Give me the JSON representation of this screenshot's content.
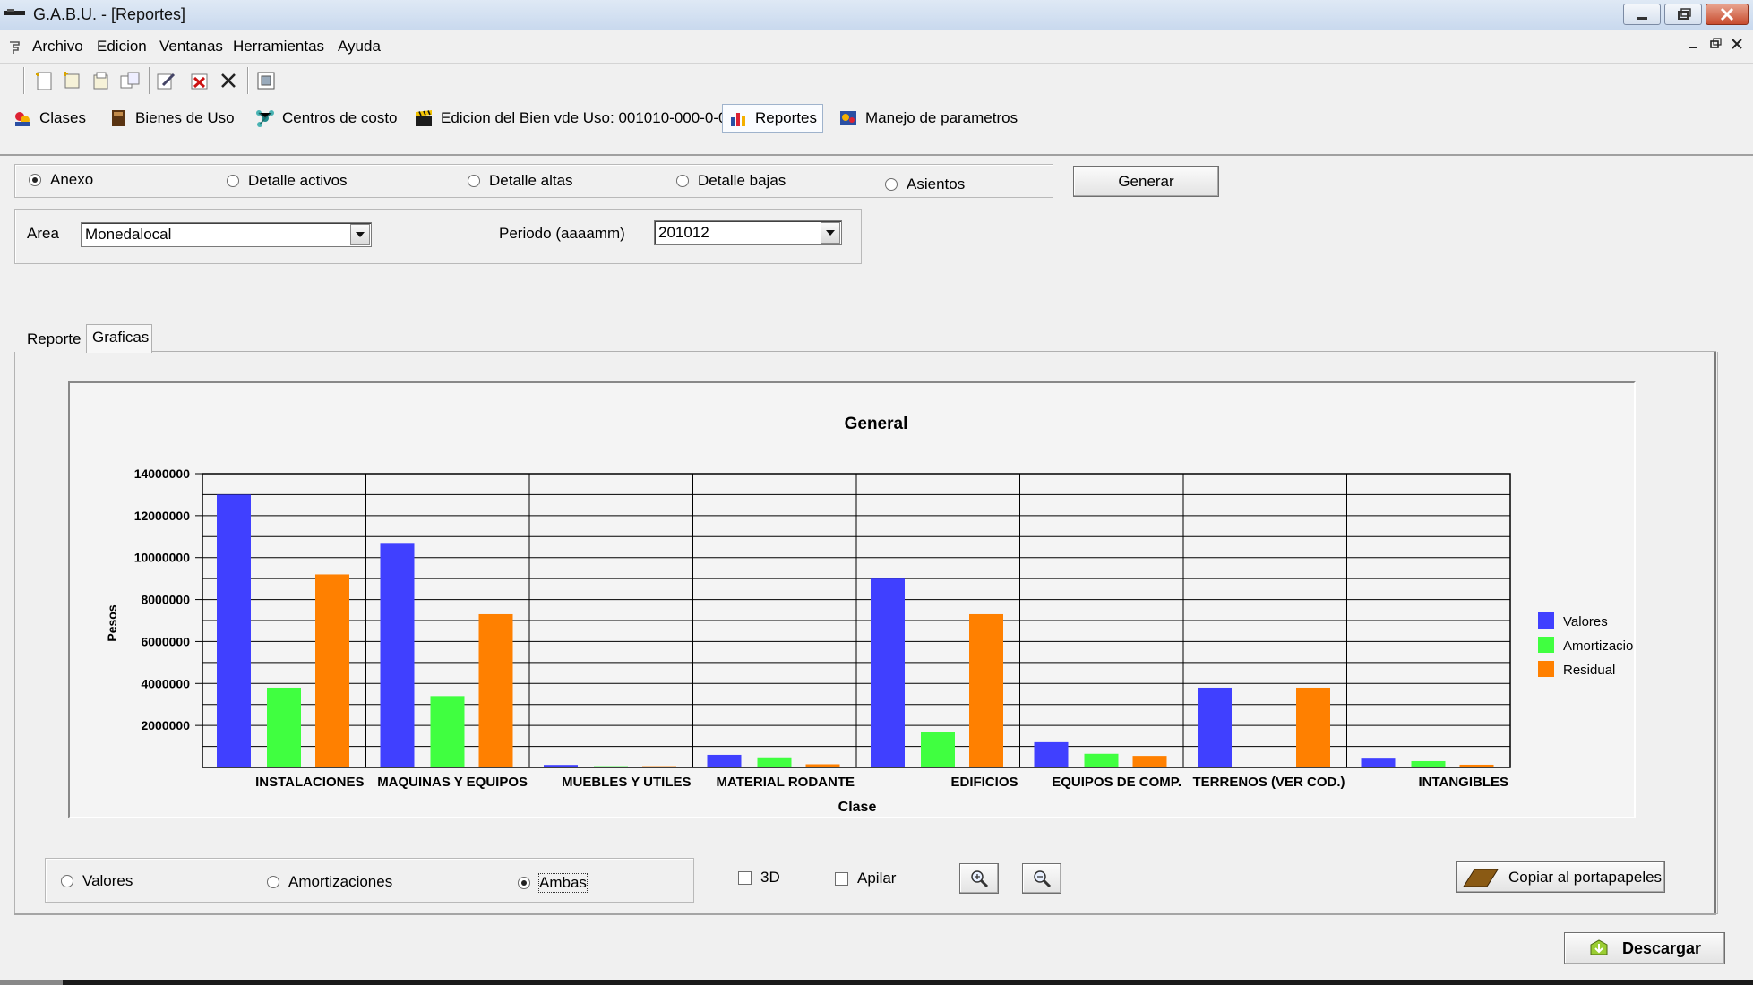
{
  "window": {
    "title": "G.A.B.U. - [Reportes]"
  },
  "menu": [
    "Archivo",
    "Edicion",
    "Ventanas",
    "Herramientas",
    "Ayuda"
  ],
  "toolbar_icons": [
    "new-icon",
    "open-icon",
    "save-icon",
    "copy-icon",
    "edit-icon",
    "delete-icon",
    "close-icon",
    "export-icon"
  ],
  "shortcuts": [
    {
      "label": "Clases",
      "icon": "classes-icon"
    },
    {
      "label": "Bienes de Uso",
      "icon": "book-icon"
    },
    {
      "label": "Centros de costo",
      "icon": "network-icon"
    },
    {
      "label": "Edicion del Bien vde Uso: 001010-000-0-0",
      "icon": "clapper-icon"
    },
    {
      "label": "Reportes",
      "icon": "reports-icon",
      "active": true
    },
    {
      "label": "Manejo de parametros",
      "icon": "parameters-icon"
    }
  ],
  "report_type": {
    "options": [
      "Anexo",
      "Detalle activos",
      "Detalle altas",
      "Detalle bajas",
      "Asientos"
    ],
    "selected": "Anexo"
  },
  "generate_label": "Generar",
  "area": {
    "label": "Area",
    "value": "Monedalocal"
  },
  "periodo": {
    "label": "Periodo (aaaamm)",
    "value": "201012"
  },
  "tabs": {
    "reporte": "Reporte",
    "graficas": "Graficas",
    "active": "Graficas"
  },
  "chart_data": {
    "type": "bar",
    "title": "General",
    "xlabel": "Clase",
    "ylabel": "Pesos",
    "ylim": [
      0,
      14000000
    ],
    "yticks": [
      "14000000",
      "12000000",
      "10000000",
      "8000000",
      "6000000",
      "4000000",
      "2000000"
    ],
    "categories": [
      "INSTALACIONES",
      "MAQUINAS Y EQUIPOS",
      "MUEBLES Y UTILES",
      "MATERIAL RODANTE",
      "EDIFICIOS",
      "EQUIPOS DE COMP.",
      "TERRENOS (VER COD.)",
      "INTANGIBLES"
    ],
    "series": [
      {
        "name": "Valores",
        "color": "#4040ff",
        "values": [
          13000000,
          10700000,
          120000,
          600000,
          9000000,
          1200000,
          3800000,
          420000
        ]
      },
      {
        "name": "Amortizacio",
        "color": "#40ff40",
        "values": [
          3800000,
          3400000,
          60000,
          480000,
          1700000,
          650000,
          0,
          300000
        ]
      },
      {
        "name": "Residual",
        "color": "#ff8000",
        "values": [
          9200000,
          7300000,
          60000,
          150000,
          7300000,
          550000,
          3800000,
          130000
        ]
      }
    ],
    "grid": true,
    "legend": "right"
  },
  "chart_mode": {
    "options": [
      "Valores",
      "Amortizaciones",
      "Ambas"
    ],
    "selected": "Ambas"
  },
  "checks": {
    "threed": "3D",
    "apilar": "Apilar"
  },
  "copy_label": "Copiar al portapapeles",
  "download_label": "Descargar"
}
